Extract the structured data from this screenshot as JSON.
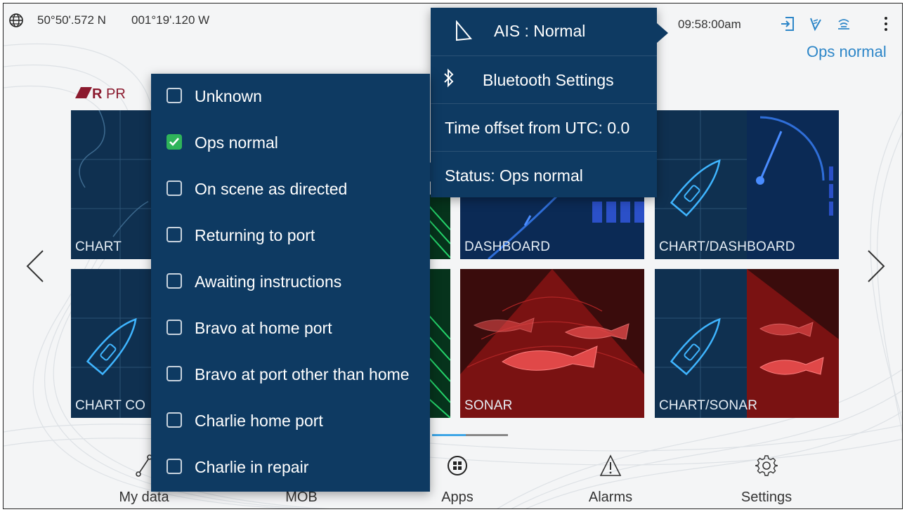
{
  "topbar": {
    "latitude": "50°50'.572 N",
    "longitude": "001°19'.120 W",
    "time": "09:58:00am",
    "ops_status": "Ops normal",
    "icons": [
      "globe-icon",
      "exit-icon",
      "satellite-signal-icon",
      "ais-status-icon",
      "more-vert-icon"
    ]
  },
  "logo": {
    "text": "PR"
  },
  "tiles": [
    {
      "label": "CHART"
    },
    {
      "label": "DASHBOARD"
    },
    {
      "label": "CHART/DASHBOARD"
    },
    {
      "label": "CHART CO"
    },
    {
      "label": "SONAR"
    },
    {
      "label": "CHART/SONAR"
    }
  ],
  "status_menu": {
    "items": [
      {
        "label": "Unknown",
        "checked": false
      },
      {
        "label": "Ops normal",
        "checked": true
      },
      {
        "label": "On scene as directed",
        "checked": false
      },
      {
        "label": "Returning to port",
        "checked": false
      },
      {
        "label": "Awaiting instructions",
        "checked": false
      },
      {
        "label": "Bravo at home port",
        "checked": false
      },
      {
        "label": "Bravo at port other than home",
        "checked": false
      },
      {
        "label": "Charlie home port",
        "checked": false
      },
      {
        "label": "Charlie in repair",
        "checked": false
      }
    ]
  },
  "info_menu": {
    "ais": "AIS : Normal",
    "bluetooth": "Bluetooth Settings",
    "utc_offset": "Time offset from UTC: 0.0",
    "status": "Status: Ops normal"
  },
  "bottom_nav": [
    {
      "label": "My data",
      "icon": "my-data-icon"
    },
    {
      "label": "MOB",
      "icon": "mob-icon"
    },
    {
      "label": "Apps",
      "icon": "apps-icon"
    },
    {
      "label": "Alarms",
      "icon": "alarm-icon"
    },
    {
      "label": "Settings",
      "icon": "gear-icon"
    }
  ],
  "colors": {
    "menu_bg": "#0e3a62",
    "accent_blue": "#2d86c8",
    "check_green": "#2fb45a",
    "brand_red": "#8b1a2e"
  }
}
